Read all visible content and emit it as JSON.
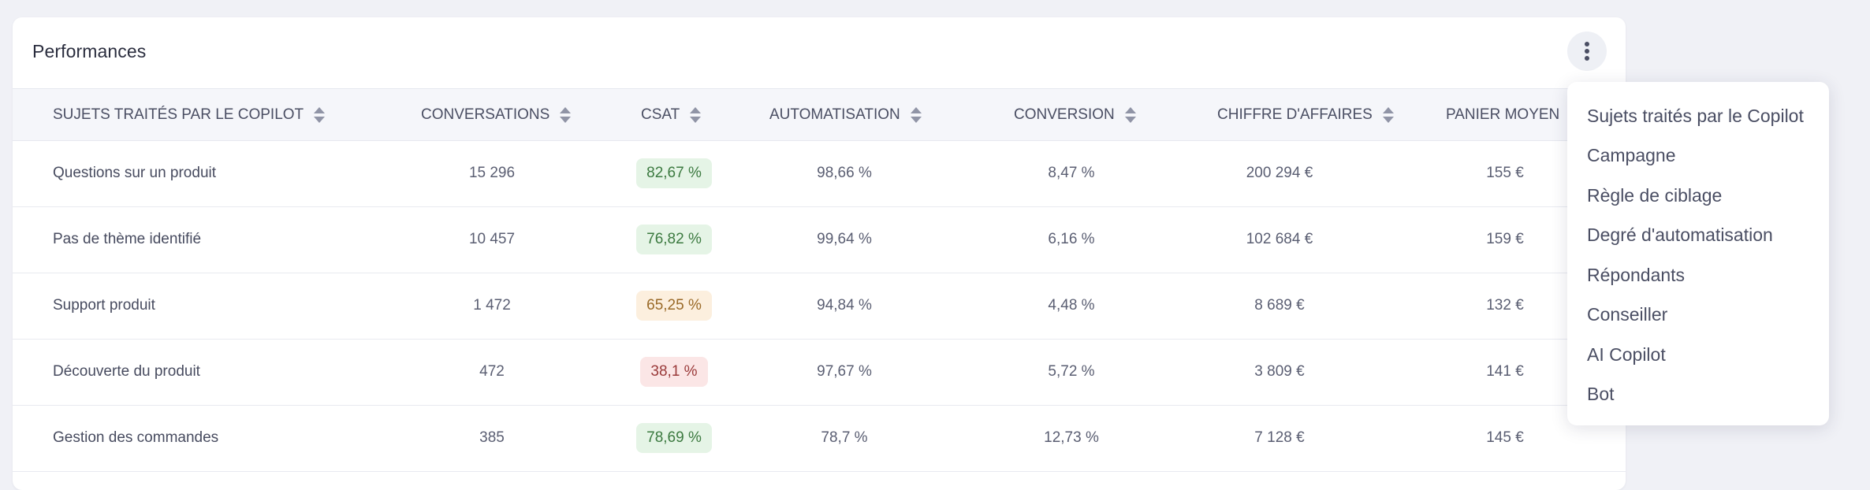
{
  "card": {
    "title": "Performances",
    "menu_icon": "more-vertical-icon"
  },
  "table": {
    "columns": [
      {
        "key": "topic",
        "label": "SUJETS TRAITÉS PAR LE COPILOT",
        "sortable": true
      },
      {
        "key": "conversations",
        "label": "CONVERSATIONS",
        "sortable": true
      },
      {
        "key": "csat",
        "label": "CSAT",
        "sortable": true
      },
      {
        "key": "automation",
        "label": "AUTOMATISATION",
        "sortable": true
      },
      {
        "key": "conversion",
        "label": "CONVERSION",
        "sortable": true
      },
      {
        "key": "revenue",
        "label": "CHIFFRE D'AFFAIRES",
        "sortable": true
      },
      {
        "key": "basket",
        "label": "PANIER MOYEN",
        "sortable": false
      }
    ],
    "rows": [
      {
        "topic": "Questions sur un produit",
        "conversations": "15 296",
        "csat": "82,67 %",
        "csat_status": "good",
        "automation": "98,66 %",
        "conversion": "8,47 %",
        "revenue": "200 294 €",
        "basket": "155 €"
      },
      {
        "topic": "Pas de thème identifié",
        "conversations": "10 457",
        "csat": "76,82 %",
        "csat_status": "good",
        "automation": "99,64 %",
        "conversion": "6,16 %",
        "revenue": "102 684 €",
        "basket": "159 €"
      },
      {
        "topic": "Support produit",
        "conversations": "1 472",
        "csat": "65,25 %",
        "csat_status": "mid",
        "automation": "94,84 %",
        "conversion": "4,48 %",
        "revenue": "8 689 €",
        "basket": "132 €"
      },
      {
        "topic": "Découverte du produit",
        "conversations": "472",
        "csat": "38,1 %",
        "csat_status": "bad",
        "automation": "97,67 %",
        "conversion": "5,72 %",
        "revenue": "3 809 €",
        "basket": "141 €"
      },
      {
        "topic": "Gestion des commandes",
        "conversations": "385",
        "csat": "78,69 %",
        "csat_status": "good",
        "automation": "78,7 %",
        "conversion": "12,73 %",
        "revenue": "7 128 €",
        "basket": "145 €"
      }
    ]
  },
  "dropdown": {
    "items": [
      {
        "label": "Sujets traités par le Copilot"
      },
      {
        "label": "Campagne"
      },
      {
        "label": "Règle de ciblage"
      },
      {
        "label": "Degré d'automatisation"
      },
      {
        "label": "Répondants"
      },
      {
        "label": "Conseiller"
      },
      {
        "label": "AI Copilot"
      },
      {
        "label": "Bot"
      }
    ]
  },
  "colors": {
    "badge_good_bg": "#e5f4e6",
    "badge_good_text": "#3c7a40",
    "badge_mid_bg": "#fcefde",
    "badge_mid_text": "#9a6a28",
    "badge_bad_bg": "#fbe6e6",
    "badge_bad_text": "#9a3a3a"
  }
}
